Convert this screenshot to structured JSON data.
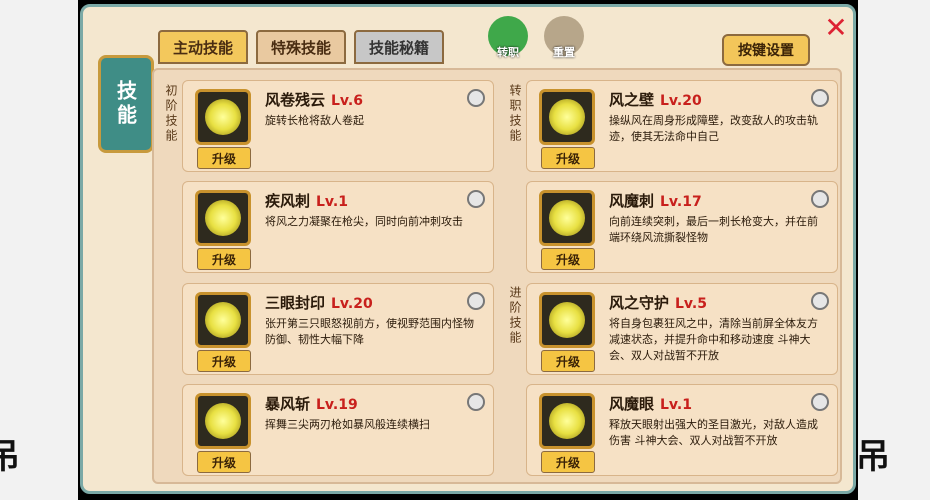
{
  "side": {
    "left_text": "吊",
    "right_text": "吊"
  },
  "tabs": [
    {
      "label": "主动技能"
    },
    {
      "label": "特殊技能"
    },
    {
      "label": "技能秘籍"
    }
  ],
  "book_label": "技能",
  "top_icons": {
    "transfer": "转职",
    "reset": "重置"
  },
  "keyset_label": "按键设置",
  "section_labels": {
    "basic": "初阶技能",
    "transfer": "转职技能",
    "advanced": "进阶技能"
  },
  "upgrade_label": "升级",
  "skills": [
    {
      "name": "风卷残云",
      "level": "Lv.6",
      "desc": "旋转长枪将敌人卷起"
    },
    {
      "name": "风之壁",
      "level": "Lv.20",
      "desc": "操纵风在周身形成障壁，改变敌人的攻击轨迹，使其无法命中自己"
    },
    {
      "name": "疾风刺",
      "level": "Lv.1",
      "desc": "将风之力凝聚在枪尖，同时向前冲刺攻击"
    },
    {
      "name": "风魔刺",
      "level": "Lv.17",
      "desc": "向前连续突刺，最后一刺长枪变大，并在前端环绕风流撕裂怪物"
    },
    {
      "name": "三眼封印",
      "level": "Lv.20",
      "desc": "张开第三只眼怒视前方，使视野范围内怪物防御、韧性大幅下降"
    },
    {
      "name": "风之守护",
      "level": "Lv.5",
      "desc": "将自身包裹狂风之中，清除当前屏全体友方减速状态，并提升命中和移动速度 斗神大会、双人对战暂不开放"
    },
    {
      "name": "暴风斩",
      "level": "Lv.19",
      "desc": "挥舞三尖两刃枪如暴风般连续横扫"
    },
    {
      "name": "风魔眼",
      "level": "Lv.1",
      "desc": "释放天眼射出强大的圣目激光，对敌人造成伤害 斗神大会、双人对战暂不开放"
    }
  ]
}
